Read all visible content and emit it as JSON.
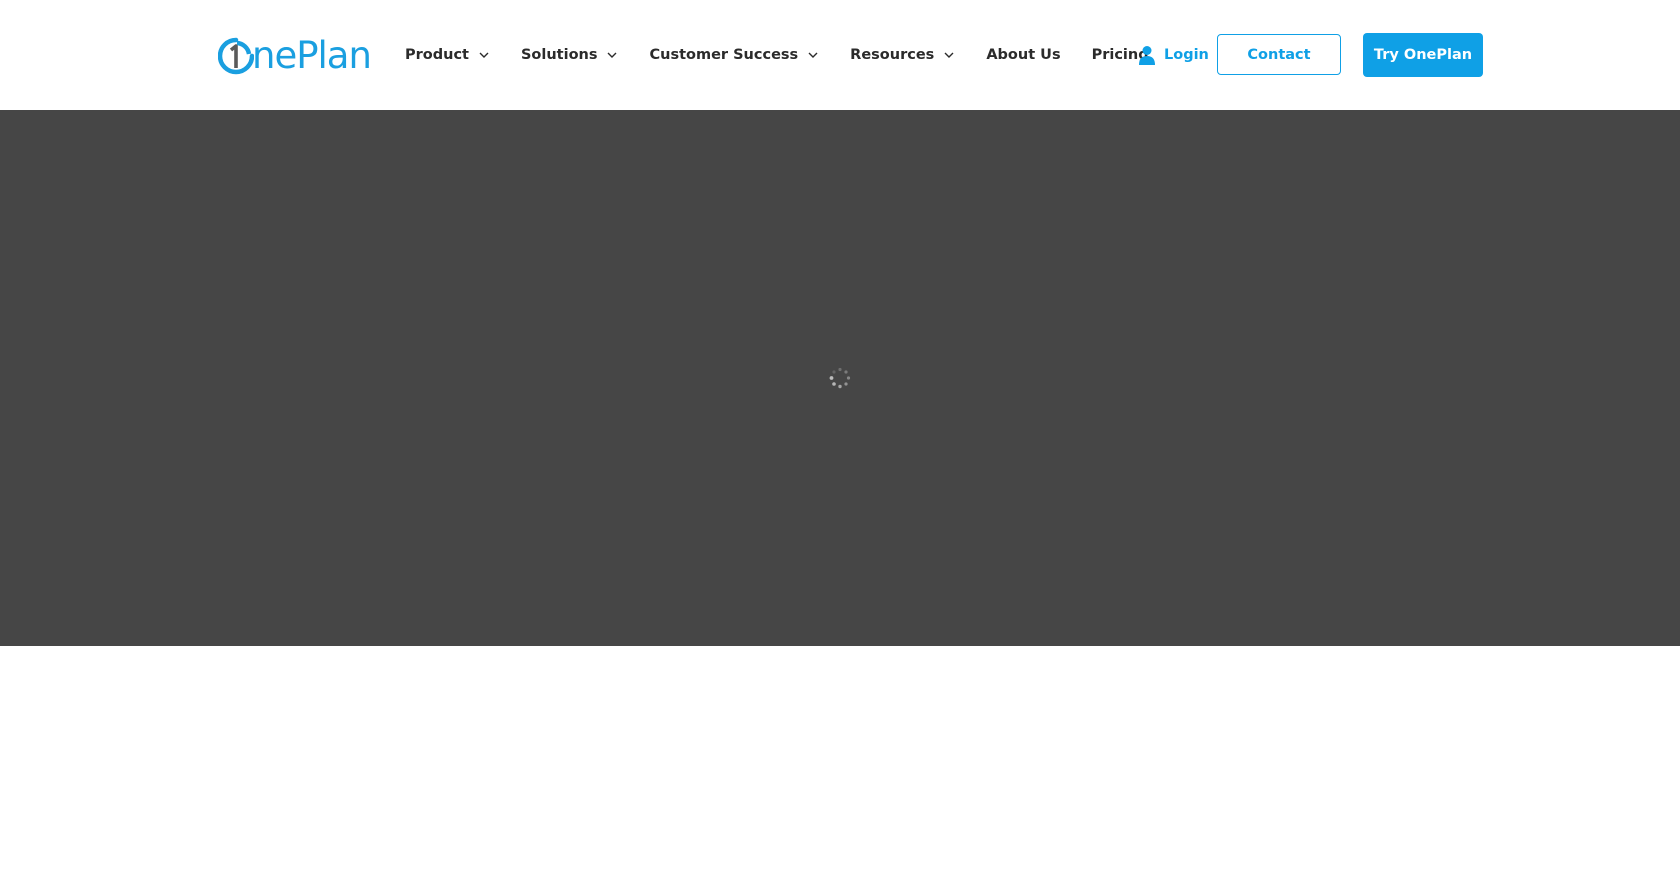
{
  "header": {
    "logo": {
      "text": "nePlan",
      "mark_icon": "oneplan-1-mark-icon",
      "brand_color": "#1a9fe0"
    },
    "nav": [
      {
        "label": "Product",
        "has_dropdown": true
      },
      {
        "label": "Solutions",
        "has_dropdown": true
      },
      {
        "label": "Customer Success",
        "has_dropdown": true
      },
      {
        "label": "Resources",
        "has_dropdown": true
      },
      {
        "label": "About Us",
        "has_dropdown": false
      },
      {
        "label": "Pricing",
        "has_dropdown": false
      }
    ],
    "login": {
      "label": "Login",
      "icon": "user-icon"
    },
    "contact_button": {
      "label": "Contact"
    },
    "try_button": {
      "label": "Try OnePlan"
    },
    "accent_color": "#0fa0e6"
  },
  "hero": {
    "background_color": "#464646",
    "loading_icon": "spinner-icon"
  }
}
